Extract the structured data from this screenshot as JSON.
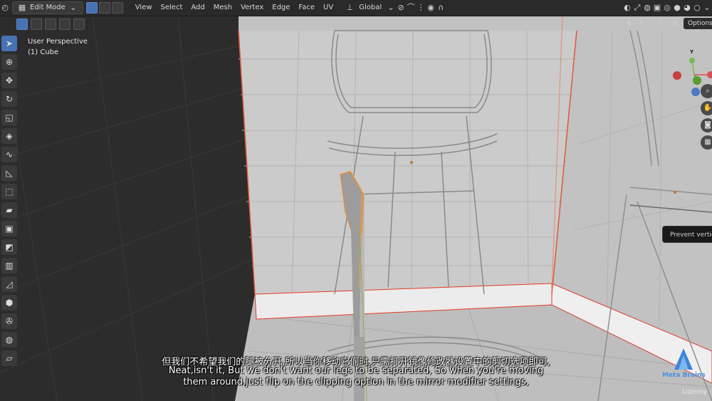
{
  "header": {
    "mode_label": "Edit Mode",
    "menu": [
      "View",
      "Select",
      "Add",
      "Mesh",
      "Vertex",
      "Edge",
      "Face",
      "UV"
    ],
    "orientation_label": "Global"
  },
  "viewport": {
    "perspective_label": "User Perspective",
    "object_label": "(1) Cube",
    "options_label": "Options",
    "axes": [
      "X",
      "Y",
      "Z"
    ],
    "gizmo_labels": [
      "X",
      "Y",
      "Z"
    ],
    "tooltip": "Prevent vertic"
  },
  "subtitles": {
    "line_cn": "但我们不希望我们的腿被分开,所以当你移动它们时,只需打开镜像修改器设置中的剪切选项即可,",
    "line_en1": "Neat,isn't it, But we don't want our legs to be separated, So when you're moving",
    "line_en2": "them around,just flip on the clipping option in the mirror modifier settings,"
  },
  "branding": {
    "logo_text": "Meta Brains",
    "watermark": "Udemy"
  },
  "colors": {
    "accent": "#4772b3",
    "selection_orange": "#f08a24",
    "header_bg": "#2a2a2a",
    "viewport_light": "#bdbdbd"
  }
}
